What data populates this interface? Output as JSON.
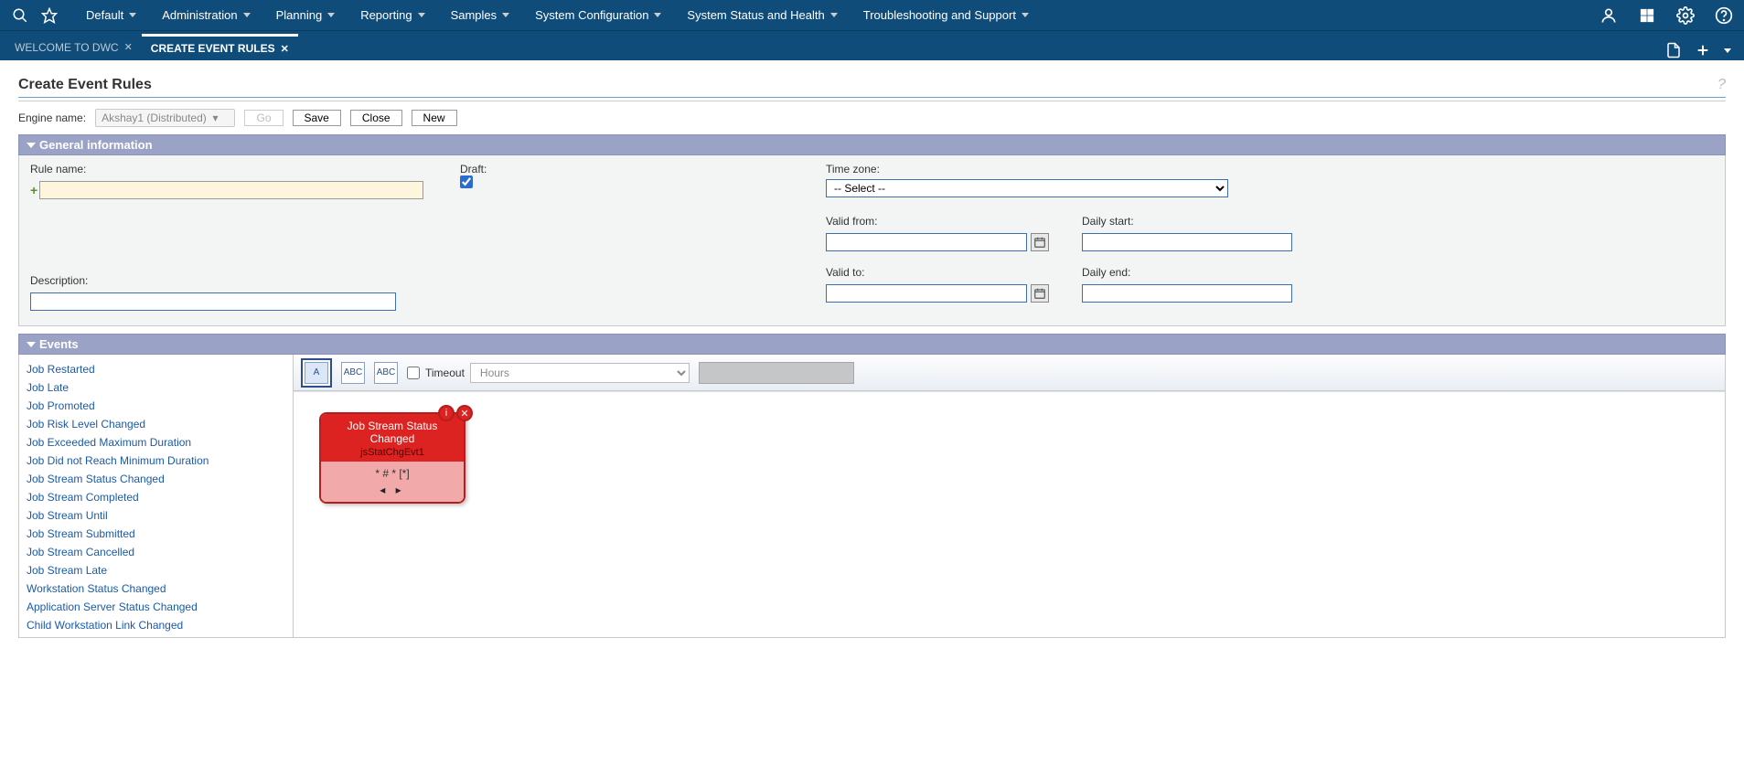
{
  "menubar": {
    "items": [
      "Default",
      "Administration",
      "Planning",
      "Reporting",
      "Samples",
      "System Configuration",
      "System Status and Health",
      "Troubleshooting and Support"
    ]
  },
  "tabs": {
    "items": [
      {
        "label": "WELCOME TO DWC",
        "active": false
      },
      {
        "label": "CREATE EVENT RULES",
        "active": true
      }
    ]
  },
  "page": {
    "title": "Create Event Rules",
    "engine_label": "Engine name:",
    "engine_value": "Akshay1 (Distributed)",
    "buttons": {
      "go": "Go",
      "save": "Save",
      "close": "Close",
      "new": "New"
    }
  },
  "sections": {
    "general": {
      "header": "General information",
      "rule_name_label": "Rule name:",
      "rule_name_value": "",
      "draft_label": "Draft:",
      "draft_checked": true,
      "description_label": "Description:",
      "description_value": "",
      "timezone_label": "Time zone:",
      "timezone_value": "-- Select --",
      "valid_from_label": "Valid from:",
      "valid_from_value": "",
      "valid_to_label": "Valid to:",
      "valid_to_value": "",
      "daily_start_label": "Daily start:",
      "daily_start_value": "",
      "daily_end_label": "Daily end:",
      "daily_end_value": ""
    },
    "events": {
      "header": "Events",
      "list": [
        "Job Restarted",
        "Job Late",
        "Job Promoted",
        "Job Risk Level Changed",
        "Job Exceeded Maximum Duration",
        "Job Did not Reach Minimum Duration",
        "Job Stream Status Changed",
        "Job Stream Completed",
        "Job Stream Until",
        "Job Stream Submitted",
        "Job Stream Cancelled",
        "Job Stream Late",
        "Workstation Status Changed",
        "Application Server Status Changed",
        "Child Workstation Link Changed"
      ],
      "canvas_toolbar": {
        "view_a_label": "A",
        "view_b_label": "ABC",
        "view_c_label": "ABC",
        "timeout_label": "Timeout",
        "timeout_unit": "Hours"
      },
      "card": {
        "title": "Job Stream Status Changed",
        "subtitle": "jsStatChgEvt1",
        "filter": "* # * [*]",
        "pager": "◂ ▸"
      }
    }
  }
}
